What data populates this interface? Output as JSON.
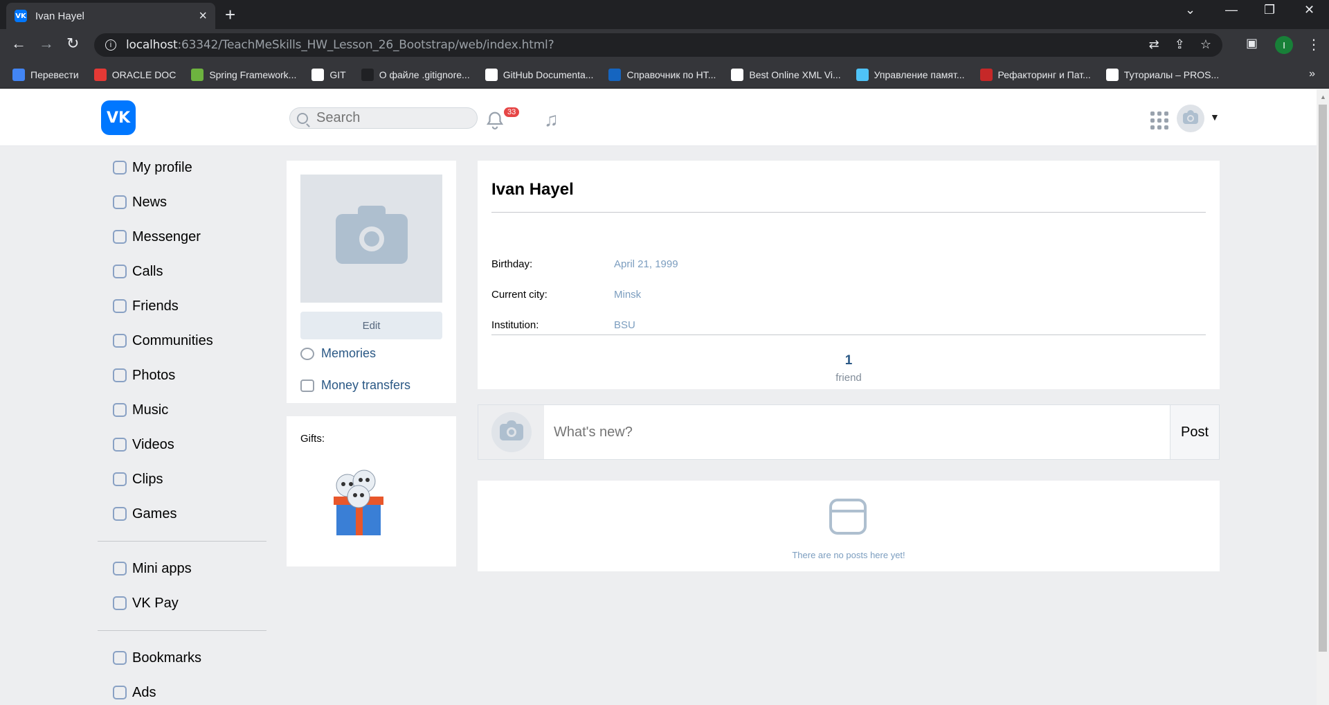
{
  "browser": {
    "tab_title": "Ivan Hayel",
    "url_host": "localhost",
    "url_rest": ":63342/TeachMeSkills_HW_Lesson_26_Bootstrap/web/index.html?",
    "profile_initial": "I",
    "bookmarks": [
      {
        "label": "Перевести",
        "color": "#4285f4"
      },
      {
        "label": "ORACLE DOC",
        "color": "#e53935"
      },
      {
        "label": "Spring Framework...",
        "color": "#6db33f"
      },
      {
        "label": "GIT",
        "color": "#ffffff"
      },
      {
        "label": "О файле .gitignore...",
        "color": "#202124"
      },
      {
        "label": "GitHub Documenta...",
        "color": "#ffffff"
      },
      {
        "label": "Справочник по HT...",
        "color": "#1565c0"
      },
      {
        "label": "Best Online XML Vi...",
        "color": "#ffffff"
      },
      {
        "label": "Управление памят...",
        "color": "#4fc3f7"
      },
      {
        "label": "Рефакторинг и Пат...",
        "color": "#c62828"
      },
      {
        "label": "Туториалы – PROS...",
        "color": "#ffffff"
      }
    ],
    "bookmarks_more": "»"
  },
  "header": {
    "logo": "VK",
    "search_placeholder": "Search",
    "notification_count": "33"
  },
  "menu": {
    "main": [
      "My profile",
      "News",
      "Messenger",
      "Calls",
      "Friends",
      "Communities",
      "Photos",
      "Music",
      "Videos",
      "Clips",
      "Games"
    ],
    "apps": [
      "Mini apps",
      "VK Pay"
    ],
    "extra": [
      "Bookmarks",
      "Ads"
    ]
  },
  "profile": {
    "edit_label": "Edit",
    "memories": "Memories",
    "money_transfers": "Money transfers",
    "gifts_label": "Gifts:",
    "name": "Ivan Hayel",
    "birthday_label": "Birthday:",
    "birthday": "April 21, 1999",
    "city_label": "Current city:",
    "city": "Minsk",
    "institution_label": "Institution:",
    "institution": "BSU",
    "friends_count": "1",
    "friends_label": "friend"
  },
  "post": {
    "placeholder": "What's new?",
    "button": "Post"
  },
  "wall": {
    "empty_text": "There are no posts here yet!"
  },
  "colors": {
    "vk_blue": "#0077ff",
    "link": "#2a5885",
    "muted": "#7b9dbf"
  }
}
